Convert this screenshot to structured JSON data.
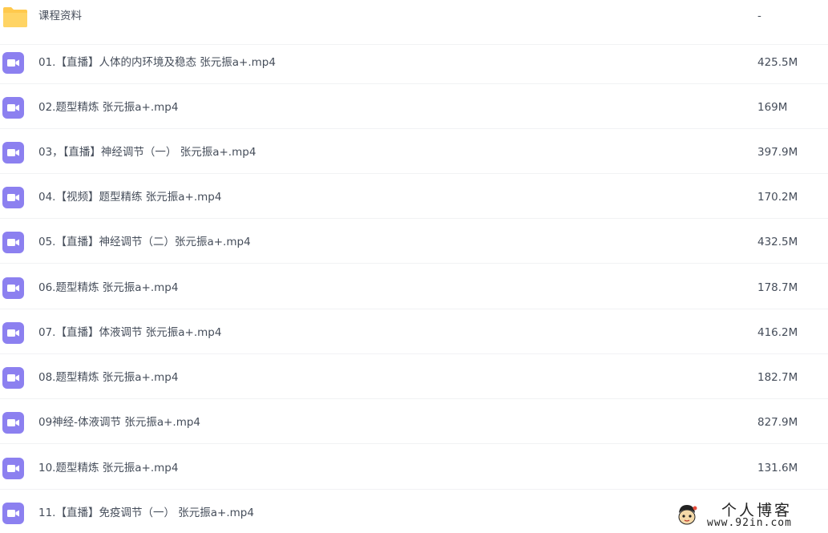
{
  "folder": {
    "name": "课程资料",
    "size": "-"
  },
  "files": [
    {
      "name": "01.【直播】人体的内环境及稳态 张元振a+.mp4",
      "size": "425.5M"
    },
    {
      "name": "02.题型精炼 张元振a+.mp4",
      "size": "169M"
    },
    {
      "name": "03，【直播】神经调节（一） 张元振a+.mp4",
      "size": "397.9M"
    },
    {
      "name": "04.【视频】题型精练 张元振a+.mp4",
      "size": "170.2M"
    },
    {
      "name": "05.【直播】神经调节（二）张元振a+.mp4",
      "size": "432.5M"
    },
    {
      "name": "06.题型精炼 张元振a+.mp4",
      "size": "178.7M"
    },
    {
      "name": "07.【直播】体液调节 张元振a+.mp4",
      "size": "416.2M"
    },
    {
      "name": "08.题型精炼 张元振a+.mp4",
      "size": "182.7M"
    },
    {
      "name": "09神经-体液调节 张元振a+.mp4",
      "size": "827.9M"
    },
    {
      "name": "10.题型精炼 张元振a+.mp4",
      "size": "131.6M"
    },
    {
      "name": "11.【直播】免疫调节（一） 张元振a+.mp4",
      "size": ""
    }
  ],
  "watermark": {
    "title": "个人博客",
    "url": "www.92in.com"
  },
  "icons": {
    "folder": "folder-icon",
    "video": "video-file-icon"
  },
  "colors": {
    "folder": "#ffc94d",
    "video": "#8c80f0",
    "text": "#454d5a",
    "separator": "#f1f2f4"
  }
}
